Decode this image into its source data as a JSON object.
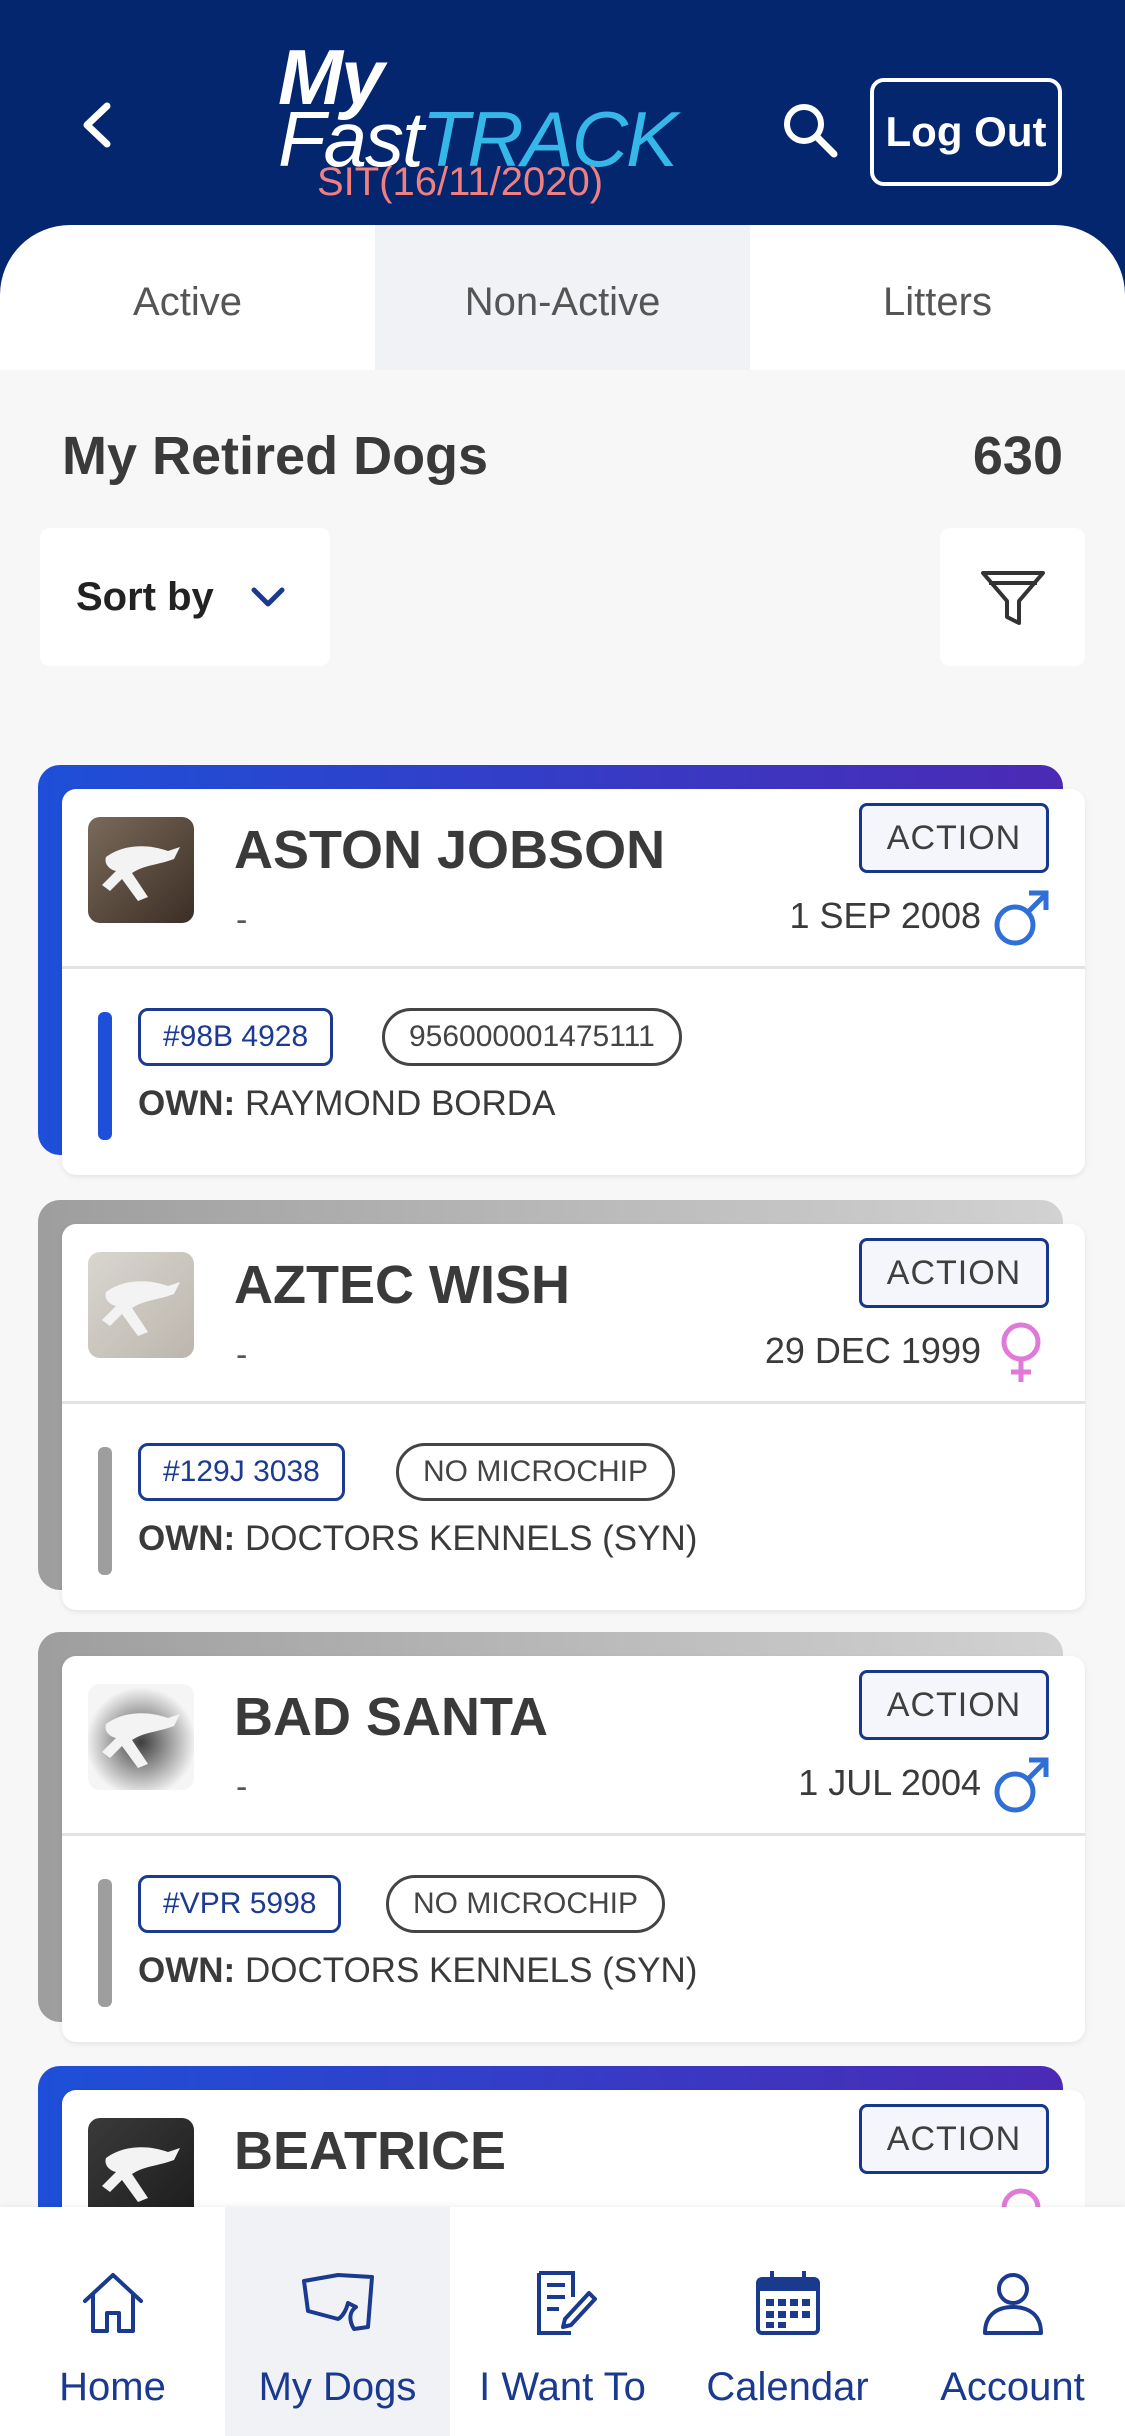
{
  "header": {
    "logo_my": "My",
    "logo_fast": "Fast",
    "logo_track": "TRACK",
    "env": "SIT(16/11/2020)",
    "logout_label": "Log Out"
  },
  "tabs": [
    {
      "label": "Active",
      "active": false
    },
    {
      "label": "Non-Active",
      "active": true
    },
    {
      "label": "Litters",
      "active": false
    }
  ],
  "list": {
    "title": "My Retired Dogs",
    "count": "630",
    "sort_label": "Sort by"
  },
  "dogs": [
    {
      "name": "ASTON JOBSON",
      "sub": "-",
      "action": "ACTION",
      "date": "1 SEP 2008",
      "sex": "male",
      "ear_tag": "#98B 4928",
      "chip": "956000001475111",
      "owner_label": "OWN:",
      "owner": "RAYMOND BORDA",
      "accent": "#1e4fd8"
    },
    {
      "name": "AZTEC WISH",
      "sub": "-",
      "action": "ACTION",
      "date": "29 DEC 1999",
      "sex": "female",
      "ear_tag": "#129J 3038",
      "chip": "NO MICROCHIP",
      "owner_label": "OWN:",
      "owner": "DOCTORS KENNELS (SYN)",
      "accent": "#9e9e9e"
    },
    {
      "name": "BAD SANTA",
      "sub": "-",
      "action": "ACTION",
      "date": "1 JUL 2004",
      "sex": "male",
      "ear_tag": "#VPR 5998",
      "chip": "NO MICROCHIP",
      "owner_label": "OWN:",
      "owner": "DOCTORS KENNELS (SYN)",
      "accent": "#9e9e9e"
    },
    {
      "name": "BEATRICE",
      "sub": "",
      "action": "ACTION",
      "date": "",
      "sex": "female",
      "ear_tag": "",
      "chip": "",
      "owner_label": "",
      "owner": "",
      "accent": "#1e4fd8"
    }
  ],
  "nav": [
    {
      "label": "Home",
      "icon": "home-icon",
      "active": false
    },
    {
      "label": "My Dogs",
      "icon": "dog-icon",
      "active": true
    },
    {
      "label": "I Want To",
      "icon": "edit-document-icon",
      "active": false
    },
    {
      "label": "Calendar",
      "icon": "calendar-icon",
      "active": false
    },
    {
      "label": "Account",
      "icon": "account-icon",
      "active": false
    }
  ],
  "colors": {
    "header_bg": "#03266f",
    "brand_blue": "#1a3a8f",
    "male_blue": "#2f6fd6",
    "female_pink": "#e07ad8",
    "env_red": "#f08080"
  }
}
